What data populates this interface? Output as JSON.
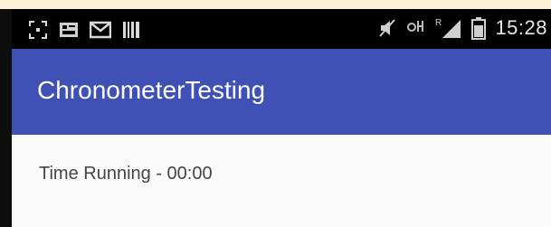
{
  "status_bar": {
    "time": "15:28",
    "left_icons": [
      "screenshot-icon",
      "image-icon",
      "mail-icon",
      "barcode-icon"
    ],
    "right_icons": [
      "mute-icon",
      "data-signal-icon",
      "roaming-signal-icon",
      "battery-icon"
    ],
    "roaming_label": "R"
  },
  "app_bar": {
    "title": "ChronometerTesting",
    "color": "#3f51b5"
  },
  "content": {
    "chronometer_text": "Time Running - 00:00"
  }
}
